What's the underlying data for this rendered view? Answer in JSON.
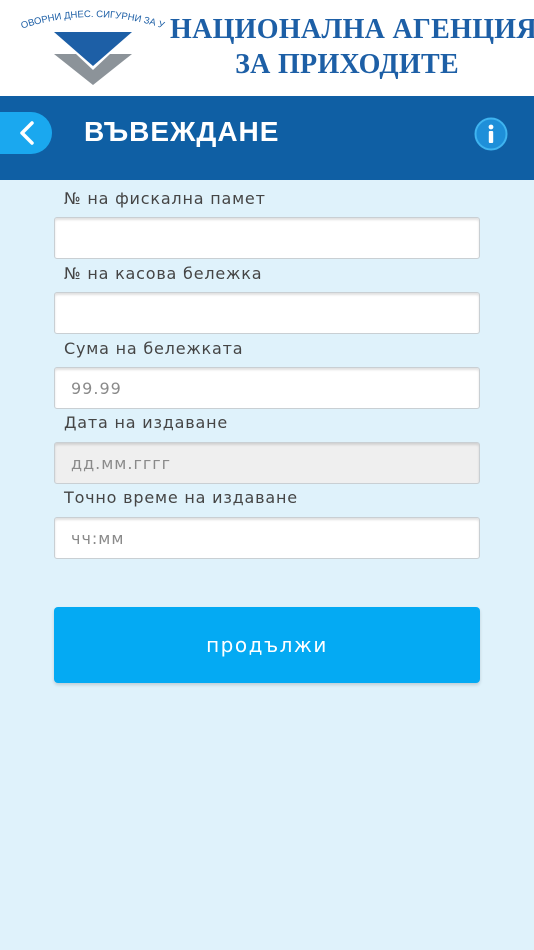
{
  "header": {
    "tagline": "ОТГОВОРНИ ДНЕС. СИГУРНИ ЗА УТРЕ",
    "agency_line1": "НАЦИОНАЛНА АГЕНЦИЯ",
    "agency_line2": "ЗА ПРИХОДИТЕ",
    "brand_color": "#1d5fa6"
  },
  "topbar": {
    "title": "ВЪВЕЖДАНЕ",
    "back_icon": "chevron-left-icon",
    "info_icon": "info-icon",
    "bar_color": "#0f5fa4",
    "accent_color": "#1aa8ef"
  },
  "form": {
    "fields": [
      {
        "label": "№ на фискална памет",
        "value": "",
        "placeholder": ""
      },
      {
        "label": "№ на касова бележка",
        "value": "",
        "placeholder": ""
      },
      {
        "label": "Сума на бележката",
        "value": "",
        "placeholder": "99.99"
      },
      {
        "label": "Дата на издаване",
        "value": "",
        "placeholder": "дд.мм.гггг"
      },
      {
        "label": "Точно време на издаване",
        "value": "",
        "placeholder": "чч:мм"
      }
    ],
    "submit_label": "продължи",
    "button_color": "#04aaf3"
  }
}
